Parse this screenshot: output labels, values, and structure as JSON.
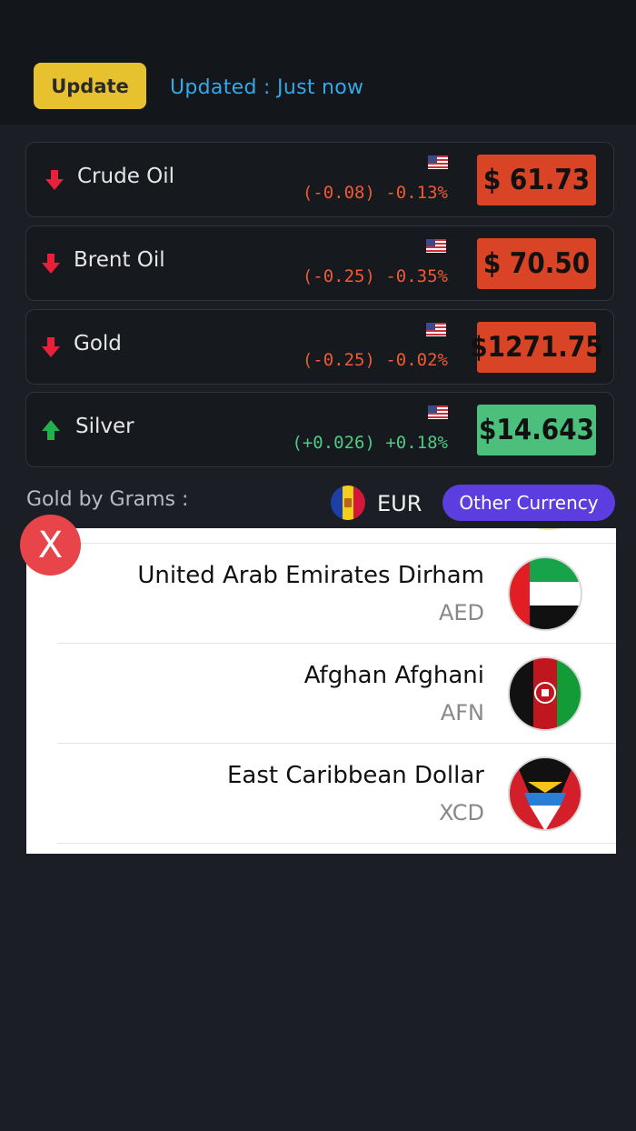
{
  "header": {
    "update_label": "Update",
    "updated_text": "Updated : Just now"
  },
  "commodities": [
    {
      "name": "Crude Oil",
      "change": "(-0.08) -0.13%",
      "price": "$ 61.73",
      "direction": "down",
      "flag": "us-flag-icon"
    },
    {
      "name": "Brent Oil",
      "change": "(-0.25) -0.35%",
      "price": "$ 70.50",
      "direction": "down",
      "flag": "us-flag-icon"
    },
    {
      "name": "Gold",
      "change": "(-0.25) -0.02%",
      "price": "$1271.75",
      "direction": "down",
      "flag": "us-flag-icon"
    },
    {
      "name": "Silver",
      "change": "(+0.026) +0.18%",
      "price": "$14.643",
      "direction": "up",
      "flag": "us-flag-icon"
    }
  ],
  "grams": {
    "label": "Gold by Grams :",
    "currency_code": "EUR",
    "currency_flag": "andorra-flag-icon",
    "other_currency_label": "Other Currency"
  },
  "currency_list": [
    {
      "name": "United Arab Emirates Dirham",
      "code": "AED",
      "flag": "uae-flag-icon"
    },
    {
      "name": "Afghan Afghani",
      "code": "AFN",
      "flag": "afghanistan-flag-icon"
    },
    {
      "name": "East Caribbean Dollar",
      "code": "XCD",
      "flag": "antigua-flag-icon"
    }
  ],
  "close_label": "X",
  "colors": {
    "accent_yellow": "#e8c12e",
    "link_blue": "#35a8e6",
    "down_red": "#d94426",
    "up_green": "#4cbf7d",
    "purple": "#5b3de0",
    "close_red": "#e8454a"
  }
}
